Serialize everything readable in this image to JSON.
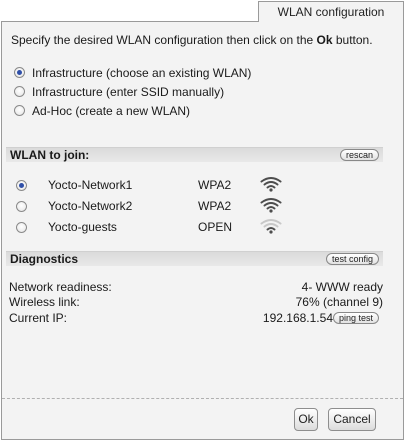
{
  "tab": {
    "title": "WLAN configuration"
  },
  "intro": {
    "before": "Specify the desired WLAN configuration then click on the ",
    "bold": "Ok",
    "after": " button."
  },
  "modes": [
    {
      "label": "Infrastructure (choose an existing WLAN)",
      "checked": true
    },
    {
      "label": "Infrastructure (enter SSID manually)",
      "checked": false
    },
    {
      "label": "Ad-Hoc (create a new WLAN)",
      "checked": false
    }
  ],
  "wlan_section": {
    "title": "WLAN to join:",
    "rescan_label": "rescan"
  },
  "networks": [
    {
      "name": "Yocto-Network1",
      "security": "WPA2",
      "checked": true,
      "signal_bars": 4,
      "signal_icon": "wifi-signal-icon"
    },
    {
      "name": "Yocto-Network2",
      "security": "WPA2",
      "checked": false,
      "signal_bars": 4,
      "signal_icon": "wifi-signal-icon"
    },
    {
      "name": "Yocto-guests",
      "security": "OPEN",
      "checked": false,
      "signal_bars": 2,
      "signal_icon": "wifi-signal-icon"
    }
  ],
  "diagnostics": {
    "title": "Diagnostics",
    "test_config_label": "test config",
    "rows": [
      {
        "label": "Network readiness:",
        "value": "4- WWW ready"
      },
      {
        "label": "Wireless link:",
        "value": "76% (channel 9)"
      },
      {
        "label": "Current IP:",
        "value": "192.168.1.54"
      }
    ],
    "ping_label": "ping test"
  },
  "footer": {
    "ok_label": "Ok",
    "cancel_label": "Cancel"
  },
  "colors": {
    "signal_strong": "#4d4d4d",
    "signal_weak": "#c8c8c8",
    "radio_dot": "#2f4fa8"
  }
}
